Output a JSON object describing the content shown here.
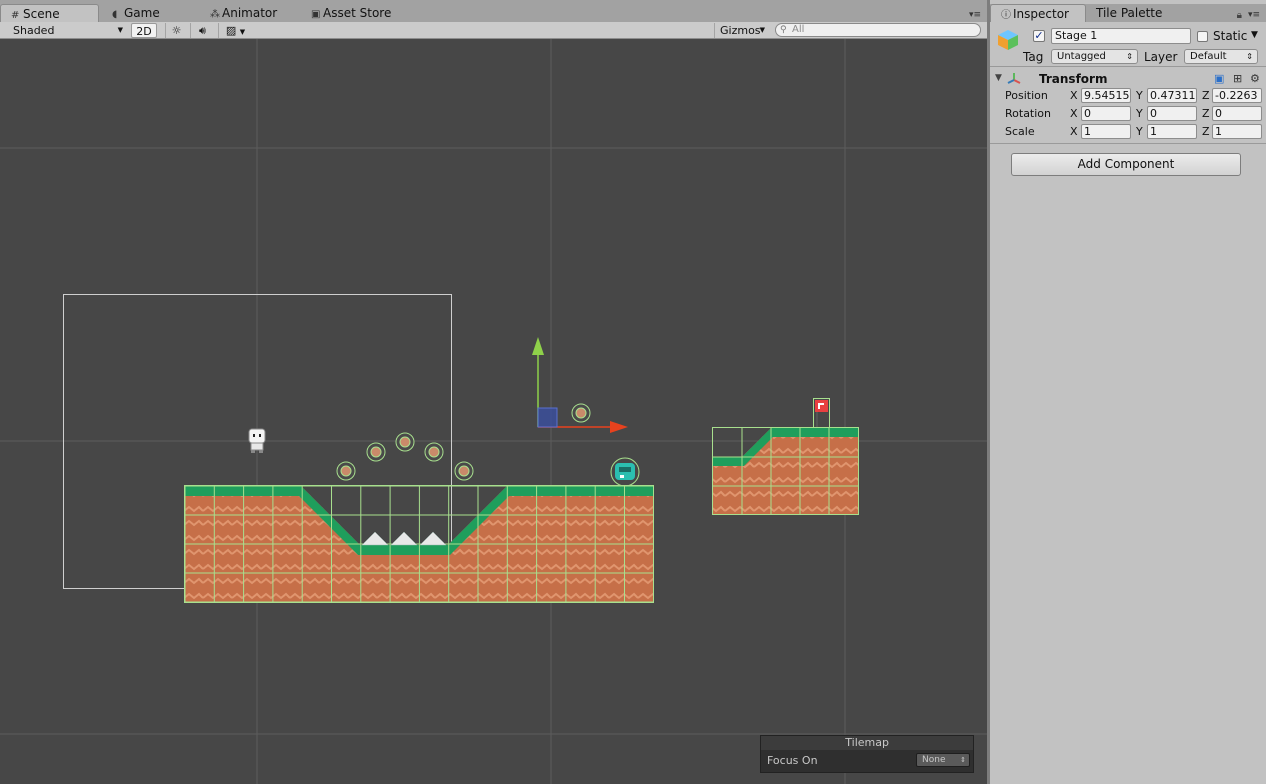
{
  "scene_tabs": [
    {
      "label": "Scene",
      "icon": "grid-icon",
      "active": true
    },
    {
      "label": "Game",
      "icon": "pacman-icon"
    },
    {
      "label": "Animator",
      "icon": "nodes-icon"
    },
    {
      "label": "Asset Store",
      "icon": "bag-icon"
    }
  ],
  "toolbar": {
    "draw_mode": "Shaded",
    "mode_2d": "2D",
    "gizmos": "Gizmos",
    "search_placeholder": "All"
  },
  "tilemap_overlay": {
    "title": "Tilemap",
    "focus_label": "Focus On",
    "focus_value": "None"
  },
  "inspector_tabs": [
    {
      "label": "Inspector",
      "icon": "info-icon",
      "active": true
    },
    {
      "label": "Tile Palette"
    }
  ],
  "gameobject": {
    "name": "Stage 1",
    "active": true,
    "static_label": "Static",
    "tag_label": "Tag",
    "tag_value": "Untagged",
    "layer_label": "Layer",
    "layer_value": "Default"
  },
  "transform": {
    "title": "Transform",
    "position": {
      "label": "Position",
      "x": "9.54515",
      "y": "0.47311",
      "z": "-0.2263"
    },
    "rotation": {
      "label": "Rotation",
      "x": "0",
      "y": "0",
      "z": "0"
    },
    "scale": {
      "label": "Scale",
      "x": "1",
      "y": "1",
      "z": "1"
    }
  },
  "axis_labels": {
    "x": "X",
    "y": "Y",
    "z": "Z"
  },
  "add_component_label": "Add Component",
  "colors": {
    "viewport_bg": "#474747",
    "grass": "#1f9e5c",
    "dirt": "#c66f48",
    "tile_grid": "#a8e08e",
    "gizmo_y": "#8fd14a",
    "gizmo_x": "#e8421e",
    "gizmo_plane": "#3a4fa0",
    "enemy": "#2bbfb0"
  }
}
